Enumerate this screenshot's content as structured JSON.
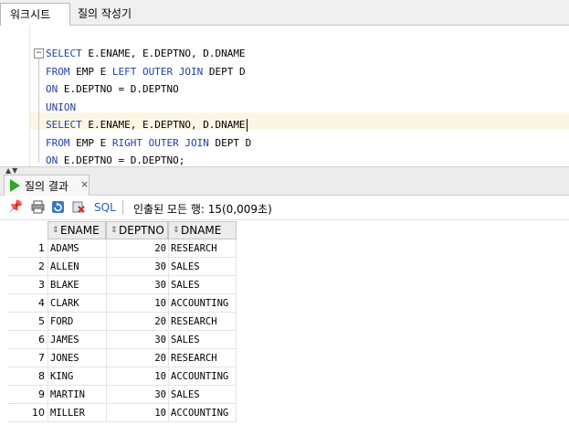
{
  "tabs": [
    {
      "label": "워크시트"
    },
    {
      "label": "질의 작성기"
    }
  ],
  "editor": {
    "lines": [
      [
        {
          "t": "SELECT",
          "k": 1
        },
        {
          "t": " E.ENAME, E.DEPTNO, D.DNAME",
          "k": 0
        }
      ],
      [
        {
          "t": "FROM",
          "k": 1
        },
        {
          "t": " EMP E ",
          "k": 0
        },
        {
          "t": "LEFT OUTER JOIN",
          "k": 1
        },
        {
          "t": " DEPT D",
          "k": 0
        }
      ],
      [
        {
          "t": "ON",
          "k": 1
        },
        {
          "t": " E.DEPTNO = D.DEPTNO",
          "k": 0
        }
      ],
      [
        {
          "t": "UNION",
          "k": 1
        }
      ],
      [
        {
          "t": "SELECT",
          "k": 1
        },
        {
          "t": " E.ENAME, E.DEPTNO, D.DNAME",
          "k": 0
        }
      ],
      [
        {
          "t": "FROM",
          "k": 1
        },
        {
          "t": " EMP E ",
          "k": 0
        },
        {
          "t": "RIGHT OUTER JOIN",
          "k": 1
        },
        {
          "t": " DEPT D",
          "k": 0
        }
      ],
      [
        {
          "t": "ON",
          "k": 1
        },
        {
          "t": " E.DEPTNO = D.DEPTNO;",
          "k": 0
        }
      ]
    ],
    "current_line": 4
  },
  "result_panel": {
    "tab_label": "질의 결과",
    "close_label": "×",
    "toolbar": {
      "icons": [
        "pin-icon",
        "print-icon",
        "refresh-icon",
        "cancel-icon"
      ],
      "sql_label": "SQL",
      "status": "인출된 모든 행: 15(0,009초)"
    },
    "grid": {
      "columns": [
        "ENAME",
        "DEPTNO",
        "DNAME"
      ],
      "sort_glyph": "⇕",
      "rows": [
        {
          "n": "1",
          "ename": "ADAMS",
          "deptno": "20",
          "dname": "RESEARCH"
        },
        {
          "n": "2",
          "ename": "ALLEN",
          "deptno": "30",
          "dname": "SALES"
        },
        {
          "n": "3",
          "ename": "BLAKE",
          "deptno": "30",
          "dname": "SALES"
        },
        {
          "n": "4",
          "ename": "CLARK",
          "deptno": "10",
          "dname": "ACCOUNTING"
        },
        {
          "n": "5",
          "ename": "FORD",
          "deptno": "20",
          "dname": "RESEARCH"
        },
        {
          "n": "6",
          "ename": "JAMES",
          "deptno": "30",
          "dname": "SALES"
        },
        {
          "n": "7",
          "ename": "JONES",
          "deptno": "20",
          "dname": "RESEARCH"
        },
        {
          "n": "8",
          "ename": "KING",
          "deptno": "10",
          "dname": "ACCOUNTING"
        },
        {
          "n": "9",
          "ename": "MARTIN",
          "deptno": "30",
          "dname": "SALES"
        },
        {
          "n": "10",
          "ename": "MILLER",
          "deptno": "10",
          "dname": "ACCOUNTING"
        }
      ]
    }
  },
  "colors": {
    "keyword": "#1f3fa8",
    "current_line": "#fbf6e4",
    "run_icon": "#2da82a",
    "sql_link": "#2a56c6"
  }
}
